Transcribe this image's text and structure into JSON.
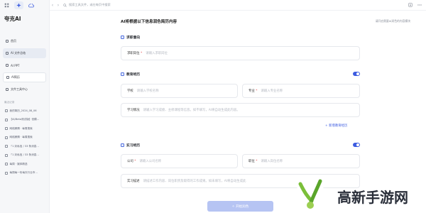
{
  "sidebar": {
    "brand": "夸克AI",
    "items": [
      {
        "label": "首页",
        "icon": "home-icon"
      },
      {
        "label": "AI 文件总结",
        "icon": "document-icon"
      },
      {
        "label": "AI PPT",
        "icon": "slides-icon"
      },
      {
        "label": "AI简历",
        "icon": "resume-icon"
      },
      {
        "label": "文件工具中心",
        "icon": "toolbox-icon"
      }
    ],
    "history_label": "最近记录",
    "history": [
      "我的简历_2024_08_06",
      "【AI/Beta测试版】但模...",
      "网络舆情 · 每周搜索",
      "网络舆情 · 每周搜索",
      "「1 封私信 / 33 条消息...",
      "「1 封私信 / 33 条消息...",
      "每周 · 媒体精选",
      "每周每一份每天行业市..."
    ]
  },
  "topbar": {
    "back": "‹",
    "forward": "›",
    "search_placeholder": "搜索工具文件，或在每页中搜索"
  },
  "main": {
    "title": "AI将根据以下信息润色简历内容",
    "subtitle_right": "请开启需要AI润色的内容模块",
    "sections": {
      "job": {
        "title": "求职意向",
        "field_label": "求职岗位",
        "field_placeholder": "请输入求职岗位"
      },
      "education": {
        "title": "教育经历",
        "school_label": "学校",
        "school_placeholder": "请输入学校名称",
        "major_label": "专业",
        "major_placeholder": "请输入专业名称",
        "study_label": "学习情况",
        "study_placeholder": "请输入学习成绩、主修课程等信息。如不填写，AI将自动生成此内容。",
        "add_link": "+ 新增教育经历",
        "enabled": true
      },
      "internship": {
        "title": "实习经历",
        "company_label": "公司",
        "company_placeholder": "请输入公司名称",
        "position_label": "职位",
        "position_placeholder": "请输入岗位名称",
        "desc_label": "实习描述",
        "desc_placeholder": "请描述工作内容、岗位职责及取得的工作成果。如未填写，AI将自动生成此",
        "enabled": true
      }
    },
    "submit_label": "✧ 开始润色"
  },
  "watermark": {
    "text": "高新手游网"
  },
  "colors": {
    "accent": "#3d5ce0",
    "sidebar_bg": "#f6f7f9",
    "submit_disabled": "#b6c4f3"
  }
}
